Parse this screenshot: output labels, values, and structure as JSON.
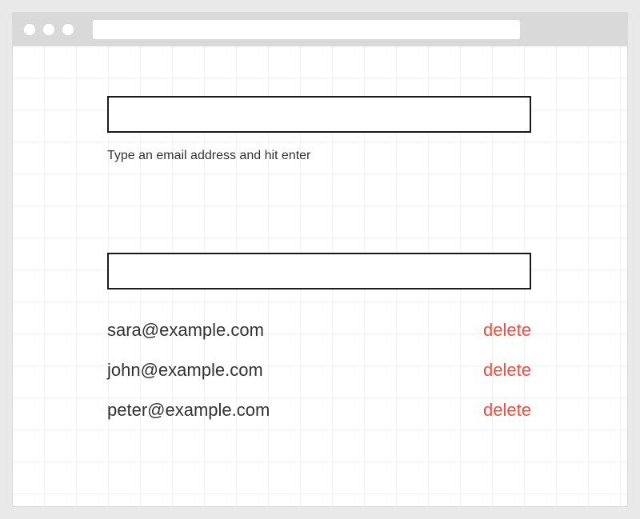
{
  "form": {
    "input_value": "",
    "helper_text": "Type an email address and hit enter"
  },
  "list_input_value": "",
  "delete_label": "delete",
  "emails": [
    {
      "address": "sara@example.com"
    },
    {
      "address": "john@example.com"
    },
    {
      "address": "peter@example.com"
    }
  ]
}
